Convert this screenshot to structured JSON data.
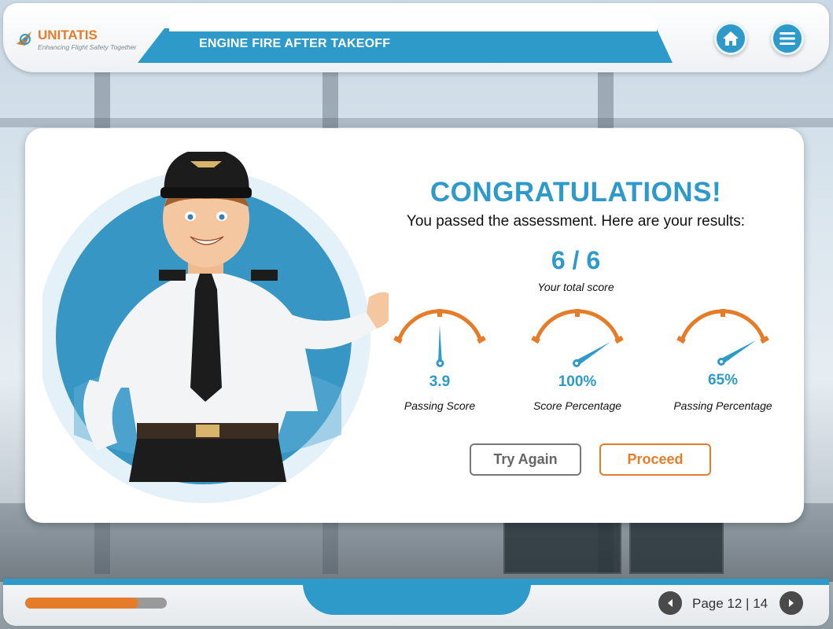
{
  "header": {
    "brand_name": "UNITATIS",
    "brand_tagline": "Enhancing Flight Safety Together",
    "course_title": "ENGINE FIRE AFTER TAKEOFF",
    "home_icon": "home-icon",
    "menu_icon": "menu-icon"
  },
  "result": {
    "heading": "CONGRATULATIONS!",
    "message": "You passed the assessment. Here are your results:",
    "total_score": "6 / 6",
    "total_score_label": "Your total score",
    "gauges": [
      {
        "value": "3.9",
        "label": "Passing Score"
      },
      {
        "value": "100%",
        "label": "Score Percentage"
      },
      {
        "value": "65%",
        "label": "Passing Percentage"
      }
    ]
  },
  "actions": {
    "try_again": "Try Again",
    "proceed": "Proceed"
  },
  "footer": {
    "progress_fraction": 0.8,
    "page_label": "Page 12 | 14",
    "prev_icon": "chevron-left-icon",
    "next_icon": "chevron-right-icon"
  },
  "colors": {
    "accent_blue": "#2e9ac9",
    "accent_orange": "#e57c2a"
  }
}
